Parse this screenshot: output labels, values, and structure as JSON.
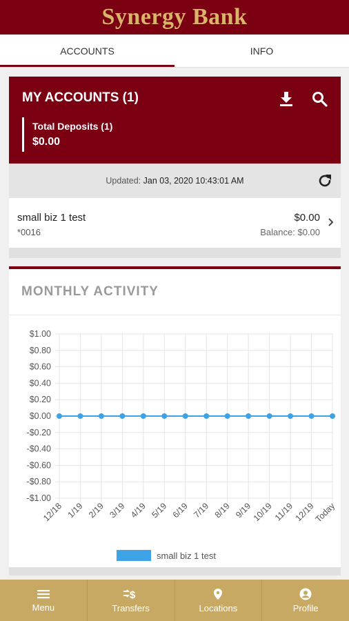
{
  "header": {
    "brand": "Synergy Bank"
  },
  "tabs": [
    {
      "label": "ACCOUNTS",
      "active": true
    },
    {
      "label": "INFO",
      "active": false
    }
  ],
  "accounts_card": {
    "title": "MY ACCOUNTS (1)",
    "icons": [
      "download-icon",
      "search-icon"
    ],
    "deposits_label": "Total Deposits (1)",
    "deposits_amount": "$0.00"
  },
  "updated": {
    "label": "Updated:",
    "timestamp": "Jan 03, 2020 10:43:01 AM",
    "icon": "refresh-icon"
  },
  "account": {
    "name": "small biz 1 test",
    "number": "*0016",
    "amount": "$0.00",
    "balance": "Balance: $0.00"
  },
  "activity": {
    "title": "MONTHLY ACTIVITY"
  },
  "chart_data": {
    "type": "line",
    "categories": [
      "12/18",
      "1/19",
      "2/19",
      "3/19",
      "4/19",
      "5/19",
      "6/19",
      "7/19",
      "8/19",
      "9/19",
      "10/19",
      "11/19",
      "12/19",
      "Today"
    ],
    "y_tick_labels": [
      "$1.00",
      "$0.80",
      "$0.60",
      "$0.40",
      "$0.20",
      "$0.00",
      "-$0.20",
      "-$0.40",
      "-$0.60",
      "-$0.80",
      "-$1.00"
    ],
    "ylim": [
      -1,
      1
    ],
    "grid": true,
    "legend_position": "bottom",
    "series": [
      {
        "name": "small biz 1 test",
        "color": "#3ea3e6",
        "values": [
          0,
          0,
          0,
          0,
          0,
          0,
          0,
          0,
          0,
          0,
          0,
          0,
          0,
          0
        ]
      }
    ]
  },
  "nav": [
    {
      "label": "Menu",
      "icon": "menu-icon"
    },
    {
      "label": "Transfers",
      "icon": "transfers-icon"
    },
    {
      "label": "Locations",
      "icon": "location-icon"
    },
    {
      "label": "Profile",
      "icon": "profile-icon"
    }
  ],
  "colors": {
    "brand": "#7a0012",
    "gold": "#c7a964",
    "series": "#3ea3e6"
  }
}
